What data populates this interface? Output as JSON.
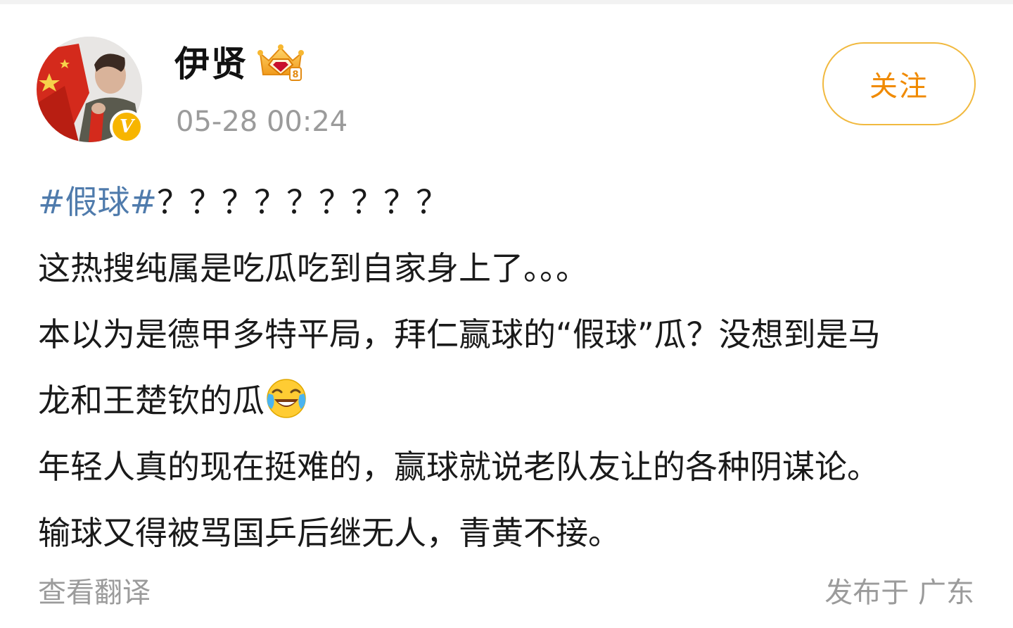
{
  "post": {
    "author": {
      "name": "伊贤",
      "verified": true,
      "verified_mark": "V",
      "vip_icon": "vip-crown-icon"
    },
    "timestamp": "05-28 00:24",
    "follow_label": "关注",
    "content": {
      "hashtag": "#假球#",
      "line1_rest": "？？？？？？？？？",
      "line2": "这热搜纯属是吃瓜吃到自家身上了。。。",
      "line3": "本以为是德甲多特平局，拜仁赢球的“假球”瓜？没想到是马",
      "line4": "龙和王楚钦的瓜",
      "line4_emoji": "laugh-cry-emoji-icon",
      "line5": "年轻人真的现在挺难的，赢球就说老队友让的各种阴谋论。",
      "line6": "输球又得被骂国乒后继无人，青黄不接。"
    },
    "translate_label": "查看翻译",
    "location": "发布于 广东"
  },
  "colors": {
    "hashtag": "#4f7bac",
    "follow": "#f08a00",
    "follow_border": "#f1b93f",
    "meta_text": "#9b9b9b",
    "verified_badge": "#f7b500"
  }
}
